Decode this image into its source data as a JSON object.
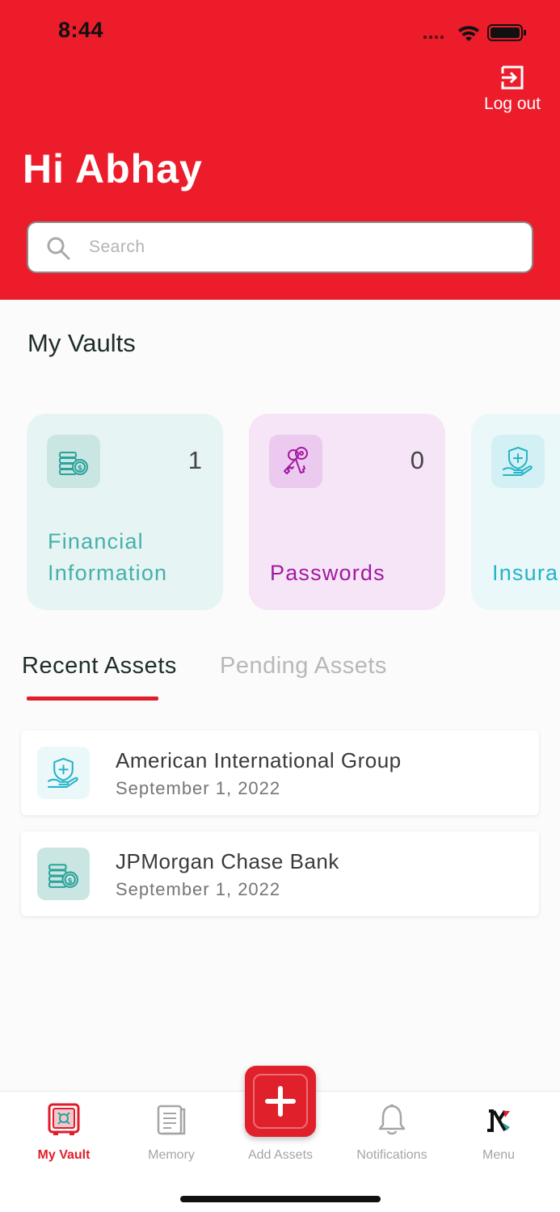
{
  "status_bar": {
    "time": "8:44"
  },
  "header": {
    "logout_label": "Log out",
    "greeting": "Hi Abhay",
    "search_placeholder": "Search"
  },
  "vaults": {
    "title": "My Vaults",
    "cards": [
      {
        "label_line1": "Financial",
        "label_line2": "Information",
        "count": "1",
        "icon": "coins-icon"
      },
      {
        "label": "Passwords",
        "count": "0",
        "icon": "keys-icon"
      },
      {
        "label": "Insura",
        "icon": "insurance-shield-icon"
      }
    ]
  },
  "tabs": {
    "recent": "Recent Assets",
    "pending": "Pending Assets",
    "active": "recent"
  },
  "assets": [
    {
      "name": "American International Group",
      "date": "September 1, 2022",
      "icon": "insurance-shield-icon"
    },
    {
      "name": "JPMorgan Chase Bank",
      "date": "September 1, 2022",
      "icon": "coins-icon"
    }
  ],
  "bottom_nav": {
    "my_vault": "My Vault",
    "memory": "Memory",
    "add_assets": "Add Assets",
    "notifications": "Notifications",
    "menu": "Menu",
    "menu_logo_text": "IX"
  },
  "colors": {
    "brand_red": "#ec1c2a",
    "financial": "#45b0ab",
    "passwords": "#a21aa3",
    "insurance": "#26b3c7"
  }
}
